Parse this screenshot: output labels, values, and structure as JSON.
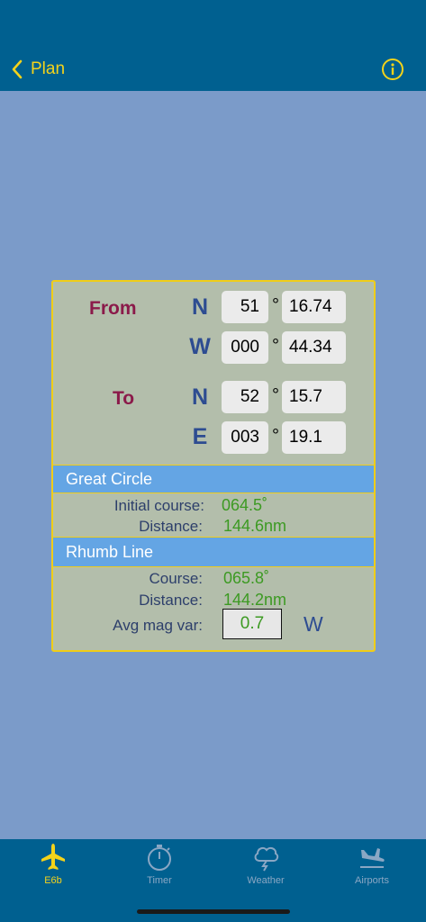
{
  "header": {
    "back_label": "Plan",
    "info_icon": "info-circle-icon"
  },
  "from": {
    "label": "From",
    "lat": {
      "hemisphere": "N",
      "degrees": "51",
      "minutes": "16.74"
    },
    "lon": {
      "hemisphere": "W",
      "degrees": "000",
      "minutes": "44.34"
    }
  },
  "to": {
    "label": "To",
    "lat": {
      "hemisphere": "N",
      "degrees": "52",
      "minutes": "15.7"
    },
    "lon": {
      "hemisphere": "E",
      "degrees": "003",
      "minutes": "19.1"
    }
  },
  "degree_symbol": "°",
  "great_circle": {
    "title": "Great Circle",
    "initial_course_label": "Initial course:",
    "initial_course_value": "064.5˚",
    "distance_label": "Distance:",
    "distance_value": "144.6nm"
  },
  "rhumb_line": {
    "title": "Rhumb Line",
    "course_label": "Course:",
    "course_value": "065.8˚",
    "distance_label": "Distance:",
    "distance_value": "144.2nm",
    "magvar_label": "Avg mag var:",
    "magvar_value": "0.7",
    "magvar_dir": "W"
  },
  "tabs": [
    {
      "label": "E6b",
      "icon": "airplane-icon",
      "active": true
    },
    {
      "label": "Timer",
      "icon": "stopwatch-icon",
      "active": false
    },
    {
      "label": "Weather",
      "icon": "thunderstorm-icon",
      "active": false
    },
    {
      "label": "Airports",
      "icon": "airplane-landing-icon",
      "active": false
    }
  ],
  "colors": {
    "header_bg": "#006090",
    "accent_yellow": "#f4d31a",
    "background": "#7b9bc9",
    "panel_bg": "#b3beab",
    "section_header": "#64a5e4",
    "value_green": "#3c9a22",
    "direction_label": "#8b1a4a"
  }
}
